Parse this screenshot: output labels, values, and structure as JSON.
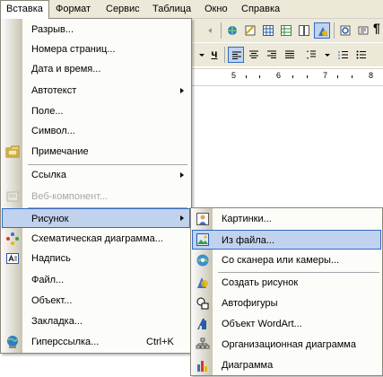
{
  "menubar": {
    "items": [
      {
        "label": "Вставка",
        "open": true
      },
      {
        "label": "Формат"
      },
      {
        "label": "Сервис"
      },
      {
        "label": "Таблица"
      },
      {
        "label": "Окно"
      },
      {
        "label": "Справка"
      }
    ]
  },
  "toolbar": {
    "bold_label": "ч",
    "pilcrow": "¶"
  },
  "ruler": {
    "numbers": [
      "5",
      "6",
      "7",
      "8"
    ]
  },
  "insert_menu": {
    "items": [
      {
        "label": "Разрыв..."
      },
      {
        "label": "Номера страниц..."
      },
      {
        "label": "Дата и время..."
      },
      {
        "label": "Автотекст",
        "submenu": true
      },
      {
        "label": "Поле..."
      },
      {
        "label": "Символ..."
      },
      {
        "label": "Примечание",
        "icon": "comment-icon"
      },
      {
        "label": "Ссылка",
        "submenu": true
      },
      {
        "label": "Веб-компонент...",
        "disabled": true,
        "icon": "web-component-icon"
      },
      {
        "label": "Рисунок",
        "submenu": true,
        "highlighted": true
      },
      {
        "label": "Схематическая диаграмма...",
        "icon": "diagram-icon"
      },
      {
        "label": "Надпись",
        "icon": "textbox-icon"
      },
      {
        "label": "Файл..."
      },
      {
        "label": "Объект..."
      },
      {
        "label": "Закладка..."
      },
      {
        "label": "Гиперссылка...",
        "shortcut": "Ctrl+K",
        "icon": "hyperlink-icon"
      }
    ]
  },
  "picture_submenu": {
    "items": [
      {
        "label": "Картинки...",
        "icon": "clipart-icon"
      },
      {
        "label": "Из файла...",
        "icon": "picture-from-file-icon",
        "highlighted": true
      },
      {
        "label": "Со сканера или камеры...",
        "icon": "scanner-icon"
      },
      {
        "label": "Создать рисунок",
        "icon": "new-drawing-icon"
      },
      {
        "label": "Автофигуры",
        "icon": "autoshapes-icon"
      },
      {
        "label": "Объект WordArt...",
        "icon": "wordart-icon"
      },
      {
        "label": "Организационная диаграмма",
        "icon": "org-chart-icon"
      },
      {
        "label": "Диаграмма",
        "icon": "chart-icon"
      }
    ]
  },
  "colors": {
    "menu_bg": "#fcfcf9",
    "highlight_bg": "#c1d2ee",
    "highlight_border": "#316ac5",
    "disabled_text": "#a7a6aa",
    "bar_bg": "#ece9d8"
  }
}
